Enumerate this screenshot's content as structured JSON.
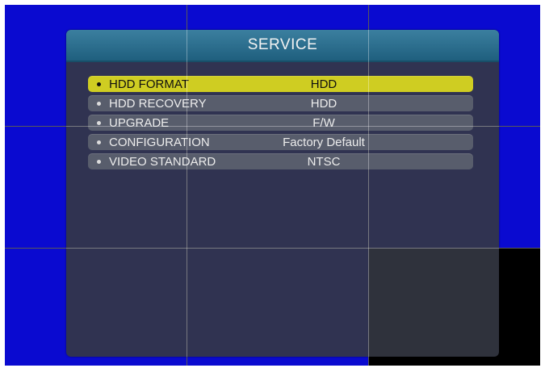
{
  "menu": {
    "title": "SERVICE",
    "items": [
      {
        "label": "HDD FORMAT",
        "value": "HDD",
        "selected": true
      },
      {
        "label": "HDD RECOVERY",
        "value": "HDD",
        "selected": false
      },
      {
        "label": "UPGRADE",
        "value": "F/W",
        "selected": false
      },
      {
        "label": "CONFIGURATION",
        "value": "Factory Default",
        "selected": false
      },
      {
        "label": "VIDEO STANDARD",
        "value": "NTSC",
        "selected": false
      }
    ]
  },
  "colors": {
    "background_blue": "#0a0ad0",
    "header_teal": "#2f7190",
    "selected_yellow": "#cfcd22",
    "item_gray": "#585d6c"
  }
}
